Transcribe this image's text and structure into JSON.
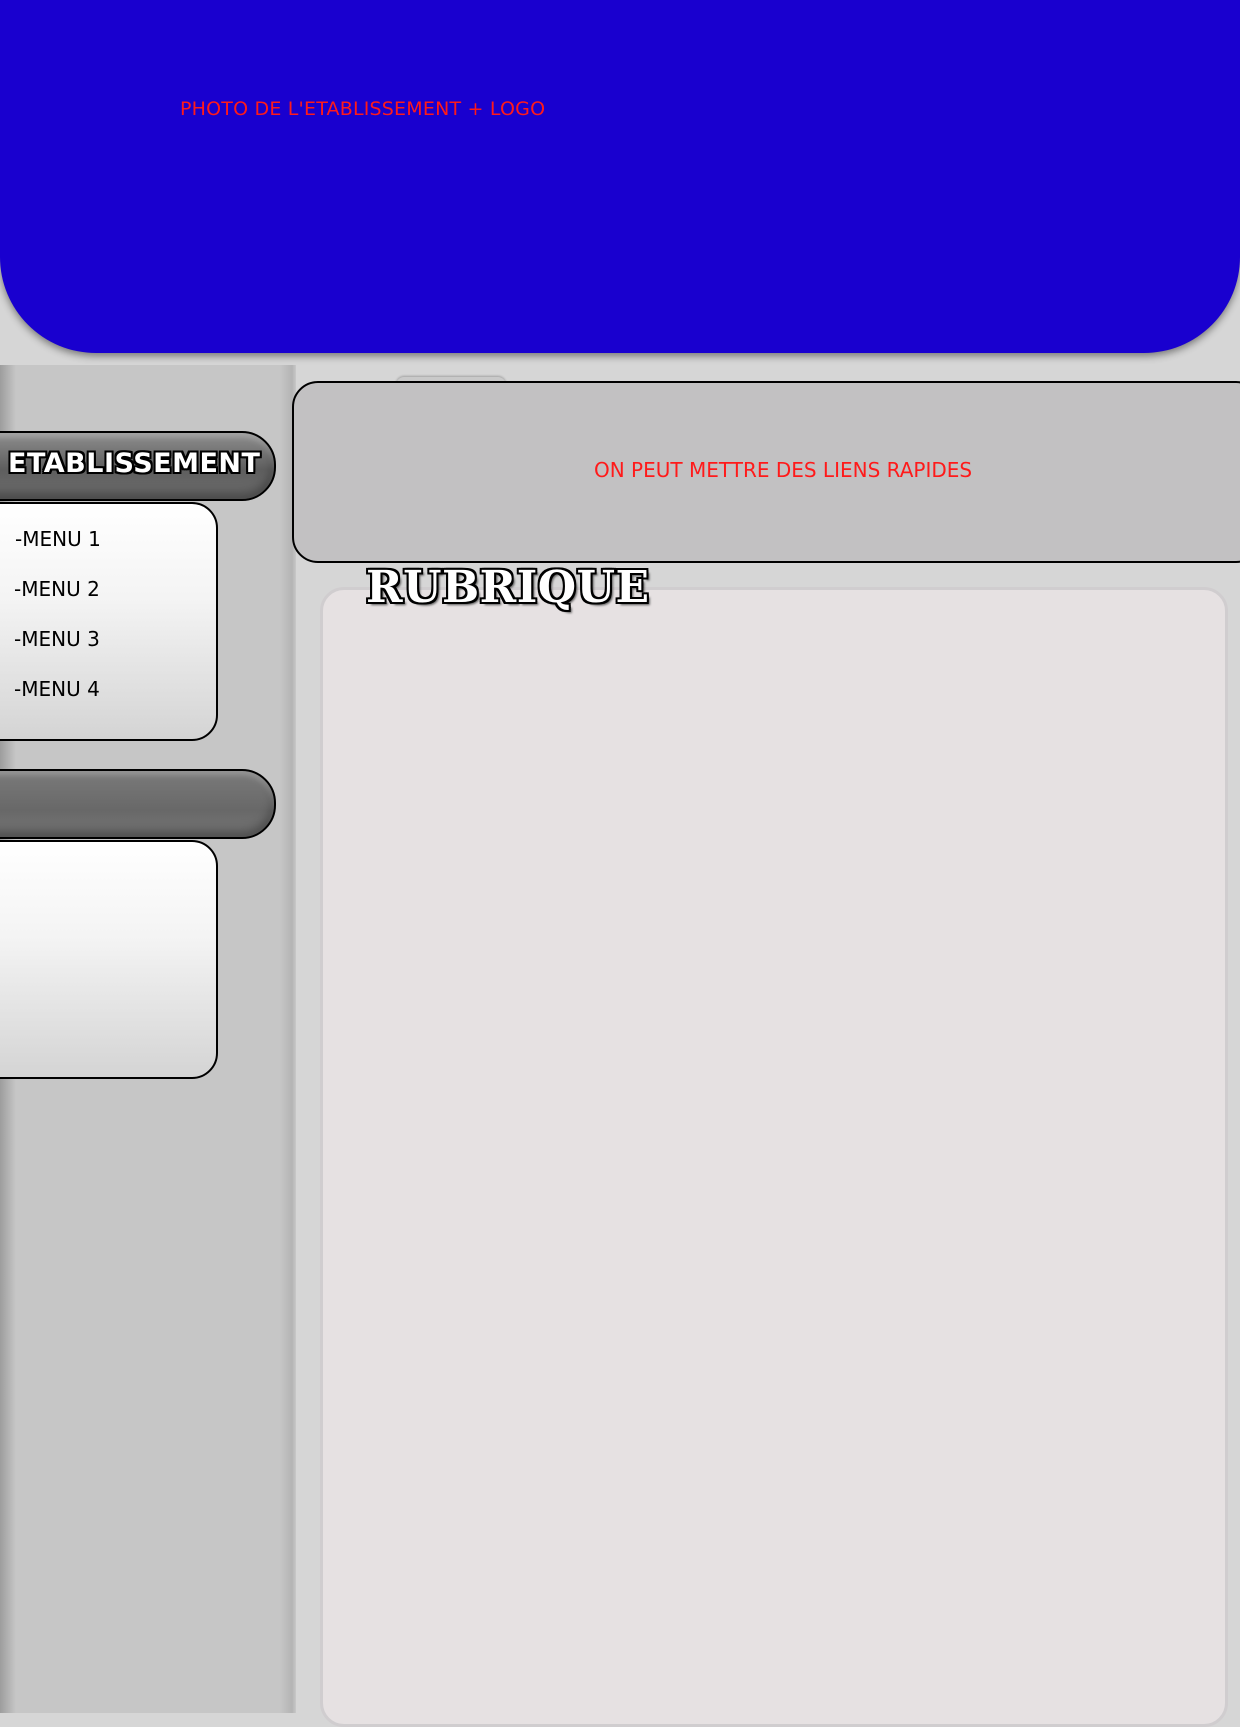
{
  "header": {
    "banner_text": "PHOTO DE L'ETABLISSEMENT + LOGO"
  },
  "sidebar": {
    "section_title": "ETABLISSEMENT",
    "menu_items": [
      {
        "label": "-MENU 1"
      },
      {
        "label": "-MENU 2"
      },
      {
        "label": "-MENU 3"
      },
      {
        "label": "-MENU 4"
      }
    ],
    "second_section_title": ""
  },
  "quick_links": {
    "text": "ON PEUT METTRE DES LIENS RAPIDES"
  },
  "main": {
    "section_title": "RUBRIQUE"
  },
  "colors": {
    "banner": "#1900cf",
    "placeholder_text": "#ff1a1a",
    "sidebar_bg": "#c6c6c6",
    "content_bg": "#e6e1e2"
  }
}
